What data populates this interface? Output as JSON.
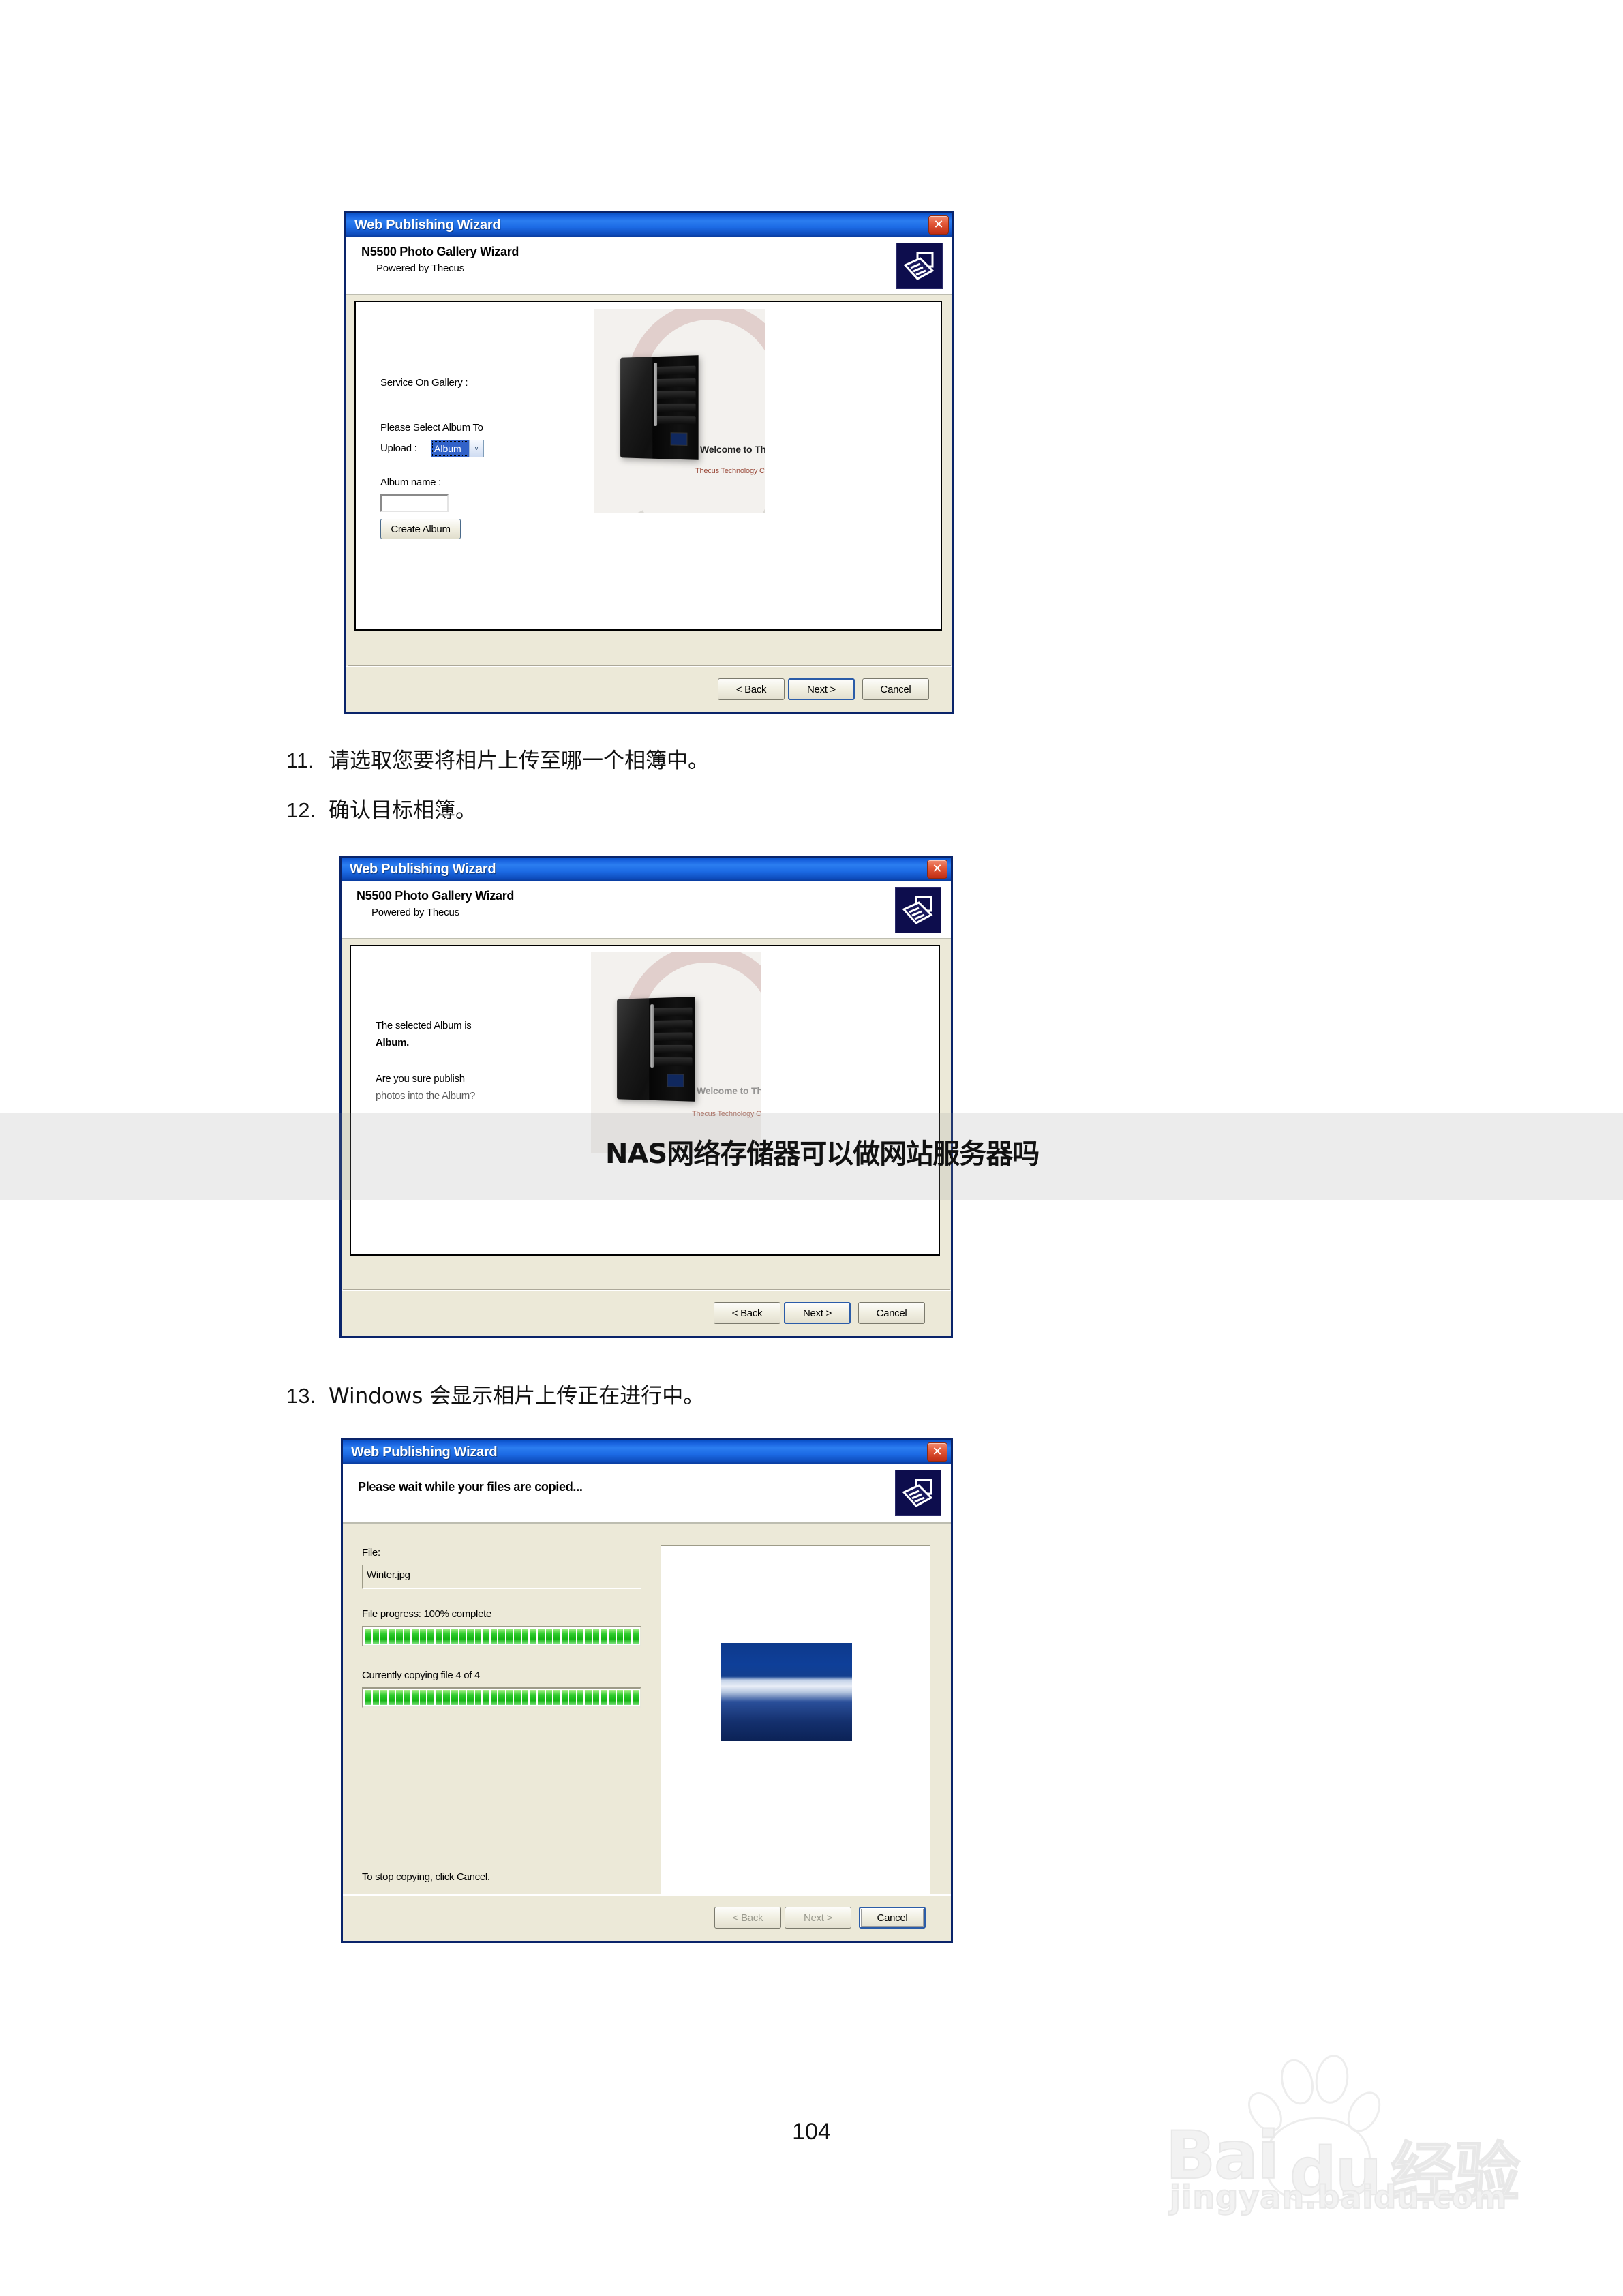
{
  "page": {
    "number": "104",
    "background": "#ffffff"
  },
  "colors": {
    "titlebar_blue": "#1a64e0",
    "dialog_border": "#0a246a",
    "dialog_face": "#ece9d8",
    "progress_green": "#14b414",
    "combo_select_blue": "#3162c8",
    "thecus_red": "#9a4a3a"
  },
  "steps": [
    {
      "number": "11.",
      "text": "请选取您要将相片上传至哪一个相簿中。"
    },
    {
      "number": "12.",
      "text": "确认目标相簿。"
    },
    {
      "number": "13.",
      "text": "Windows 会显示相片上传正在进行中。"
    }
  ],
  "dialog1": {
    "title": "Web Publishing Wizard",
    "close_label": "✕",
    "header_title": "N5500 Photo Gallery Wizard",
    "header_sub": "Powered by Thecus",
    "icon_name": "web-publish-icon",
    "service_label": "Service On Gallery :",
    "select_label_line1": "Please Select Album To",
    "select_label_line2": "Upload :",
    "combo_value": "Album",
    "combo_arrow": "˅",
    "album_name_label": "Album name :",
    "album_name_value": "",
    "create_button": "Create Album",
    "image": {
      "welcome": "Welcome to Thecus",
      "corporation": "Thecus Technology Corporation"
    },
    "buttons": {
      "back": "< Back",
      "next": "Next >",
      "cancel": "Cancel"
    }
  },
  "dialog2": {
    "title": "Web Publishing Wizard",
    "close_label": "✕",
    "header_title": "N5500 Photo Gallery Wizard",
    "header_sub": "Powered by Thecus",
    "icon_name": "web-publish-icon",
    "selected_line1": "The selected Album is",
    "selected_album": "Album.",
    "confirm_line1": "Are you sure publish",
    "confirm_line2": "photos into the Album?",
    "image": {
      "welcome": "Welcome to Thecus",
      "corporation": "Thecus Technology Corporation"
    },
    "buttons": {
      "back": "< Back",
      "next": "Next >",
      "cancel": "Cancel"
    }
  },
  "dialog3": {
    "title": "Web Publishing Wizard",
    "close_label": "✕",
    "header_title": "Please wait while your files are copied...",
    "icon_name": "web-publish-icon",
    "file_label": "File:",
    "file_name": "Winter.jpg",
    "file_progress_label": "File progress: 100% complete",
    "file_progress_percent": 100,
    "copy_count_label": "Currently copying file 4 of 4",
    "copy_progress_percent": 100,
    "stop_hint": "To stop copying, click Cancel.",
    "buttons": {
      "back": "< Back",
      "next": "Next >",
      "cancel": "Cancel"
    }
  },
  "watermarks": {
    "chinese_overlay": "NAS网络存储器可以做网站服务器吗",
    "baidu_main": "Bai",
    "baidu_main2": "du",
    "baidu_cn": "经验",
    "baidu_sub": "jingyan.baidu.com"
  }
}
